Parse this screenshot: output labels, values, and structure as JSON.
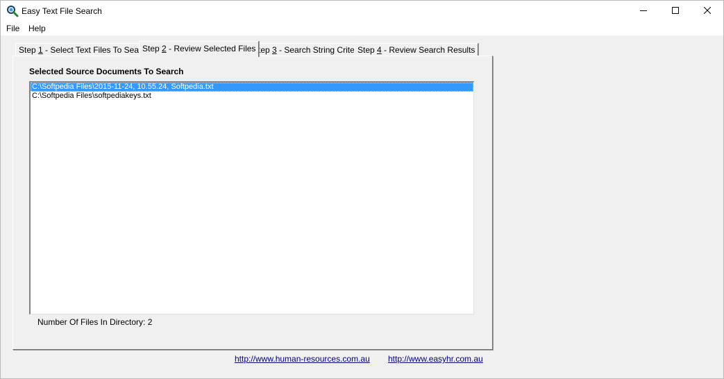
{
  "window": {
    "title": "Easy Text File Search",
    "icon": "magnifier-icon",
    "controls": {
      "minimize": "minimize-icon",
      "maximize": "maximize-icon",
      "close": "close-icon"
    }
  },
  "menu": {
    "file": "File",
    "help": "Help"
  },
  "tabs": [
    {
      "prefix": "Step ",
      "num": "1",
      "suffix": " - Select Text Files To Search",
      "active": false
    },
    {
      "prefix": "Step ",
      "num": "2",
      "suffix": " - Review Selected Files",
      "active": true
    },
    {
      "prefix": "Step ",
      "num": "3",
      "suffix": " - Search String Criteria",
      "active": false
    },
    {
      "prefix": "Step ",
      "num": "4",
      "suffix": " - Review Search Results",
      "active": false
    }
  ],
  "panel": {
    "title": "Selected Source Documents To Search",
    "files": [
      "C:\\Softpedia Files\\2015-11-24, 10.55.24, Softpedia.txt",
      "C:\\Softpedia Files\\softpediakeys.txt"
    ],
    "selected_index": 0,
    "file_count_text": "Number Of Files In Directory: 2"
  },
  "links": {
    "link1": "http://www.human-resources.com.au",
    "link2": "http://www.easyhr.com.au"
  },
  "colors": {
    "selection": "#3399ff",
    "link": "#000080",
    "background": "#f0f0f0"
  }
}
